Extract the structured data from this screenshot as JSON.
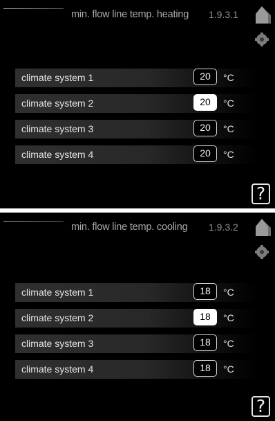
{
  "screens": [
    {
      "title": "min. flow line temp. heating",
      "menu_code": "1.9.3.1",
      "unit": "°C",
      "help_label": "?",
      "rows": [
        {
          "label": "climate system 1",
          "value": "20",
          "selected": false
        },
        {
          "label": "climate system 2",
          "value": "20",
          "selected": true
        },
        {
          "label": "climate system 3",
          "value": "20",
          "selected": false
        },
        {
          "label": "climate system 4",
          "value": "20",
          "selected": false
        }
      ]
    },
    {
      "title": "min. flow line temp. cooling",
      "menu_code": "1.9.3.2",
      "unit": "°C",
      "help_label": "?",
      "rows": [
        {
          "label": "climate system 1",
          "value": "18",
          "selected": false
        },
        {
          "label": "climate system 2",
          "value": "18",
          "selected": true
        },
        {
          "label": "climate system 3",
          "value": "18",
          "selected": false
        },
        {
          "label": "climate system 4",
          "value": "18",
          "selected": false
        }
      ]
    }
  ],
  "icons": {
    "home": "home-icon",
    "settings": "gear-icon"
  },
  "colors": {
    "background": "#000000",
    "text": "#e6e6e6",
    "header_text": "#a9a9a9",
    "selected_fill": "#ffffff"
  }
}
